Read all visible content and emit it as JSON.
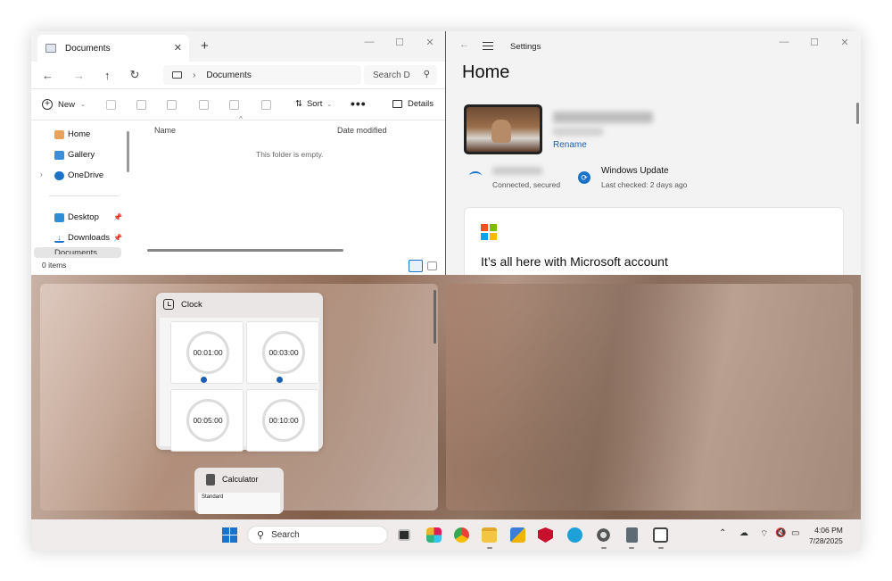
{
  "explorer": {
    "tab_title": "Documents",
    "tab_close": "✕",
    "new_tab": "+",
    "win_controls": [
      "—",
      "☐",
      "✕"
    ],
    "nav": {
      "back": "←",
      "forward": "→",
      "up": "↑",
      "refresh": "↻"
    },
    "address": "Documents",
    "address_sep": "›",
    "search_placeholder": "Search D",
    "toolbar": {
      "new_label": "New",
      "sort_label": "Sort",
      "more_label": "•••",
      "details_label": "Details"
    },
    "sidebar": {
      "home": "Home",
      "gallery": "Gallery",
      "onedrive": "OneDrive",
      "desktop": "Desktop",
      "downloads": "Downloads",
      "documents_partial": "Documents"
    },
    "columns": {
      "name": "Name",
      "date_modified": "Date modified"
    },
    "empty_message": "This folder is empty.",
    "status": "0 items"
  },
  "settings": {
    "window_title": "Settings",
    "win_controls": [
      "—",
      "☐",
      "✕"
    ],
    "page_title": "Home",
    "rename_label": "Rename",
    "wifi_status": "Connected, secured",
    "windows_update_title": "Windows Update",
    "windows_update_sub": "Last checked: 2 days ago",
    "card_title": "It’s all here with Microsoft account",
    "ms_colors": [
      "#f25022",
      "#7fba00",
      "#00a4ef",
      "#ffb900"
    ]
  },
  "snap": {
    "clock_title": "Clock",
    "timers": [
      "00:01:00",
      "00:03:00",
      "00:05:00",
      "00:10:00"
    ],
    "calculator_title": "Calculator",
    "calculator_mode": "Standard"
  },
  "taskbar": {
    "search_label": "Search",
    "time": "4:06 PM",
    "date": "7/28/2025",
    "accent": "#1a5fb4"
  }
}
